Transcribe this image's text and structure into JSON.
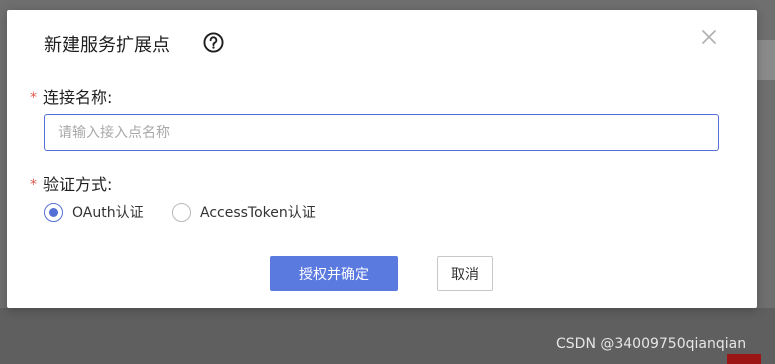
{
  "dialog": {
    "title": "新建服务扩展点",
    "name_field": {
      "required_mark": "*",
      "label": "连接名称:",
      "value": "",
      "placeholder": "请输入接入点名称"
    },
    "auth_field": {
      "required_mark": "*",
      "label": "验证方式:",
      "options": [
        {
          "label": "OAuth认证",
          "selected": true
        },
        {
          "label": "AccessToken认证",
          "selected": false
        }
      ]
    },
    "buttons": {
      "confirm_label": "授权并确定",
      "cancel_label": "取消"
    }
  },
  "watermark": "CSDN @34009750qianqian",
  "colors": {
    "accent": "#5470d6",
    "primary_button": "#5b7ae0",
    "required": "#e05a4e",
    "overlay": "#6f6f6f"
  },
  "icons": {
    "help": "question-circle-icon",
    "close": "close-icon"
  }
}
